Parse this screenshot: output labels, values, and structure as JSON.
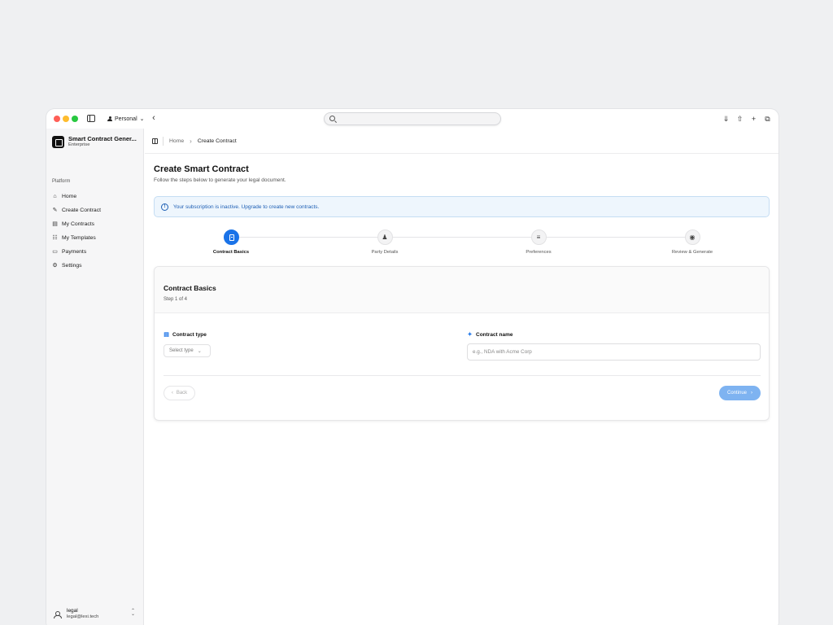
{
  "browser": {
    "profile_label": "Personal",
    "url": ""
  },
  "sidebar": {
    "brand_name": "Smart Contract Gener...",
    "brand_sub": "Enterprise",
    "section_label": "Platform",
    "items": [
      {
        "label": "Home",
        "icon": "home-icon"
      },
      {
        "label": "Create Contract",
        "icon": "file-edit-icon"
      },
      {
        "label": "My Contracts",
        "icon": "file-icon"
      },
      {
        "label": "My Templates",
        "icon": "layers-icon"
      },
      {
        "label": "Payments",
        "icon": "credit-card-icon"
      },
      {
        "label": "Settings",
        "icon": "gear-icon"
      }
    ],
    "user": {
      "name": "legal",
      "email": "legal@lexi.tech"
    }
  },
  "breadcrumb": {
    "home": "Home",
    "current": "Create Contract"
  },
  "page": {
    "title": "Create Smart Contract",
    "subtitle": "Follow the steps below to generate your legal document."
  },
  "alert": {
    "text": "Your subscription is inactive. Upgrade to create new contracts."
  },
  "steps": [
    {
      "label": "Contract Basics",
      "icon": "document-icon",
      "active": true
    },
    {
      "label": "Party Details",
      "icon": "users-icon",
      "active": false
    },
    {
      "label": "Preferences",
      "icon": "sliders-icon",
      "active": false
    },
    {
      "label": "Review & Generate",
      "icon": "eye-icon",
      "active": false
    }
  ],
  "card": {
    "title": "Contract Basics",
    "step_text": "Step 1 of 4",
    "contract_type_label": "Contract type",
    "contract_type_value": "Select type",
    "contract_name_label": "Contract name",
    "contract_name_placeholder": "e.g., NDA with Acme Corp",
    "contract_name_value": "",
    "back_label": "Back",
    "continue_label": "Continue"
  },
  "colors": {
    "accent": "#1a73e8",
    "alert_bg": "#eef6fd",
    "alert_text": "#1e5fb4",
    "continue_disabled": "#7eb3f1"
  }
}
